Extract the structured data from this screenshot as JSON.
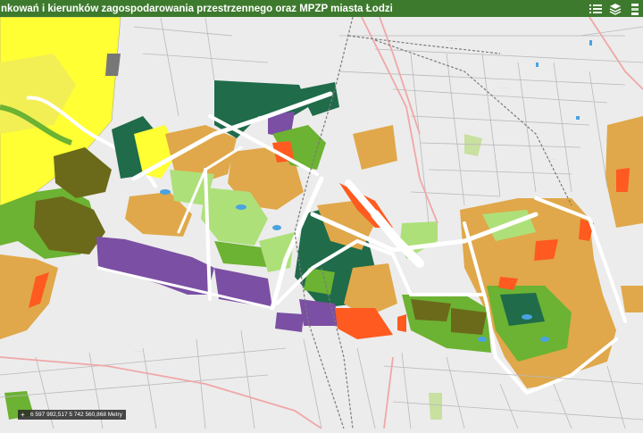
{
  "header": {
    "title": "nkowań i kierunków zagospodarowania przestrzennego oraz MPZP miasta Łodzi",
    "tools": [
      "legend-icon",
      "layers-icon",
      "basemap-icon"
    ]
  },
  "map": {
    "coordinates": "6 597 992,517 5 742 560,868 Metry",
    "colors": {
      "background": "#ececec",
      "residential_orange": "#e0a84a",
      "industrial_purple": "#7b4fa3",
      "forest_dark_green": "#1f6b4a",
      "green_space": "#6cb233",
      "light_green": "#aee07a",
      "agricultural_yellow": "#ffff33",
      "service_red": "#ff5a1f",
      "olive": "#6b6a1a",
      "road": "#ffffff",
      "railway": "#777777",
      "main_road": "#f0a7a7",
      "water": "#4aa3e0"
    }
  }
}
